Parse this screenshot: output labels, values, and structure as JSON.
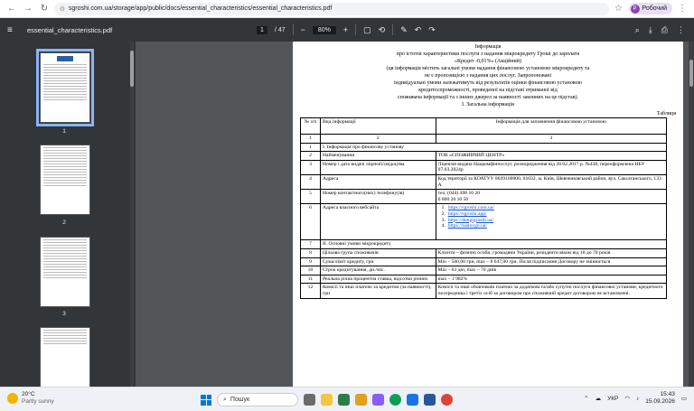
{
  "browser": {
    "url": "sgroshi.com.ua/storage/app/public/docs/essential_characteristics/essential_characteristics.pdf",
    "profile_initial": "Р",
    "profile_label": "Робочий"
  },
  "pdf_toolbar": {
    "file_name": "essential_characteristics.pdf",
    "current_page": "1",
    "total_pages": "/ 47",
    "zoom": "80%"
  },
  "thumbnails": [
    {
      "label": "1"
    },
    {
      "label": "2"
    },
    {
      "label": "3"
    }
  ],
  "document": {
    "header_lines": [
      "Інформація",
      "про істотні характеристики послуги з надання мікрокредиту Гроші до зарплати",
      "«Кредит -0,01%» (Акційний)",
      "(ця інформація містить загальні умови надання фінансовою установою мікрокредиту та",
      "не є пропозицією з надання цих послуг. Запропоновані",
      "індивідуальні умови залежатимуть від результатів оцінки фінансовою установою",
      "кредитоспроможності, проведеної на підставі отриманої від",
      "споживача інформації та з інших джерел за наявності законних на це підстав).",
      "І. Загальна інформація"
    ],
    "table_caption": "Таблиця",
    "col_headers": {
      "num": "№ з/п",
      "kind": "Вид інформації",
      "info": "Інформація для заповнення фінансовою установою"
    },
    "col_numbers": [
      "1",
      "2",
      "3"
    ],
    "section_1": "І. Інформація про фінансову установу",
    "section_2": "ІІ. Основні умови мікрокредиту",
    "rows": [
      {
        "n": "2",
        "kind": "Найменування",
        "info": "ТОВ «СПОЖИВЧИЙ ЦЕНТР»"
      },
      {
        "n": "3",
        "kind": "Номер і дата видачі ліцензії/свідоцтва",
        "info": "Ліцензія видана Нацкомфінпослуг, розпорядження від 28.02.2017 р. №438, переоформлена НБУ 07.03.2024р"
      },
      {
        "n": "4",
        "kind": "Адреса",
        "info": "Код території за КОАТУУ 8039100000, 01032, м. Київ, Шевченківський район, вул. Саксаганського, 133 А"
      },
      {
        "n": "5",
        "kind": "Номер контактного(них) телефону(ів)",
        "info": "тел. (044) 498 10 20",
        "info2": "0 800 20 10 50"
      }
    ],
    "websites_row": {
      "n": "6",
      "kind": "Адреса власного вебсайта",
      "links": [
        "https://sgroshi.com.ua/",
        "https://sgroshi.app/",
        "https://dengigroshi.ua/",
        "https://nadovgo.ua/"
      ]
    },
    "rows2": [
      {
        "n": "8",
        "kind": "Цільова група споживачів",
        "info": "Клієнти – фізичні особи, громадяни України, резиденти віком від 18 до 70 років"
      },
      {
        "n": "9",
        "kind": "Сума/ліміт кредиту, грн",
        "info": "Min – 500,00 грн, max – 8 647,00 грн. Після підписання Договору не змінюється"
      },
      {
        "n": "10",
        "kind": "Строк кредитування, дн./міс.",
        "info": "Min – 63 дні, max – 70 днів"
      },
      {
        "n": "11",
        "kind": "Реальна річна процентна ставка, відсотки річних",
        "info": "max – 1 982%"
      },
      {
        "n": "12",
        "kind": "Комісії та інші платежі за кредитом (за наявності), грн",
        "info": "Комісії та інші обов'язкові платежі за додаткові та/або супутні послуги фінансової установи, кредитного посередника і третіх осіб за договором про споживчий кредит договором не встановлені."
      }
    ]
  },
  "taskbar": {
    "temperature": "20°C",
    "condition": "Partly sunny",
    "search_placeholder": "Пошук",
    "language": "УКР",
    "time": "15:43",
    "date": "15.09.2026"
  }
}
